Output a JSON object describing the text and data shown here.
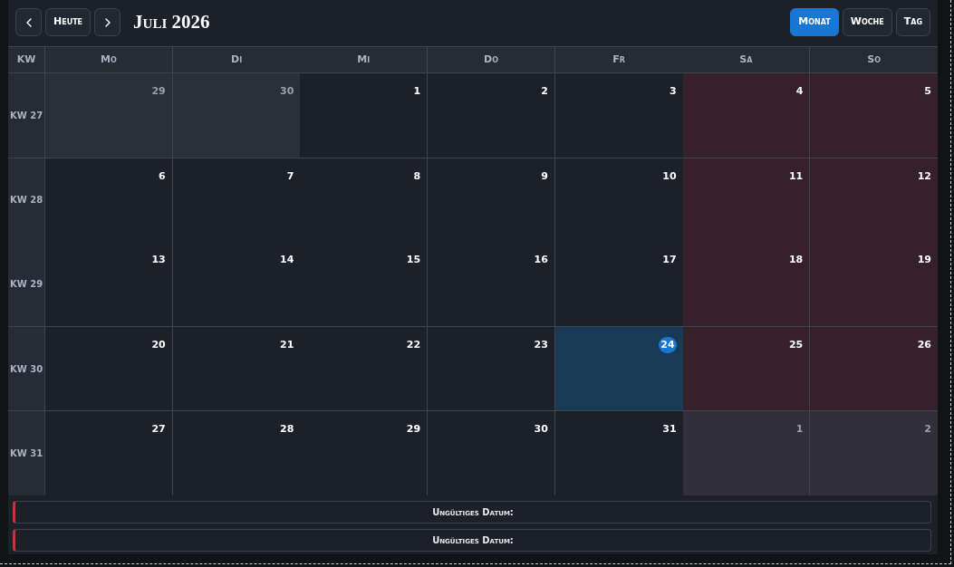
{
  "toolbar": {
    "today_button": "Heute",
    "title": "Juli 2026",
    "views": [
      {
        "label": "Monat",
        "selected": true
      },
      {
        "label": "Woche",
        "selected": false
      },
      {
        "label": "Tag",
        "selected": false
      }
    ]
  },
  "calendar": {
    "columns": [
      "KW",
      "Mo",
      "Di",
      "Mi",
      "Do",
      "Fr",
      "Sa",
      "So"
    ],
    "weeks": [
      {
        "label": "KW 27",
        "days": [
          {
            "day": "29",
            "outside_month": true,
            "weekend": false,
            "today": false
          },
          {
            "day": "30",
            "outside_month": true,
            "weekend": false,
            "today": false
          },
          {
            "day": "1",
            "outside_month": false,
            "weekend": false,
            "today": false
          },
          {
            "day": "2",
            "outside_month": false,
            "weekend": false,
            "today": false
          },
          {
            "day": "3",
            "outside_month": false,
            "weekend": false,
            "today": false
          },
          {
            "day": "4",
            "outside_month": false,
            "weekend": true,
            "today": false
          },
          {
            "day": "5",
            "outside_month": false,
            "weekend": true,
            "today": false
          }
        ]
      },
      {
        "label": "KW 28",
        "days": [
          {
            "day": "6",
            "outside_month": false,
            "weekend": false,
            "today": false
          },
          {
            "day": "7",
            "outside_month": false,
            "weekend": false,
            "today": false
          },
          {
            "day": "8",
            "outside_month": false,
            "weekend": false,
            "today": false
          },
          {
            "day": "9",
            "outside_month": false,
            "weekend": false,
            "today": false
          },
          {
            "day": "10",
            "outside_month": false,
            "weekend": false,
            "today": false
          },
          {
            "day": "11",
            "outside_month": false,
            "weekend": true,
            "today": false
          },
          {
            "day": "12",
            "outside_month": false,
            "weekend": true,
            "today": false
          }
        ]
      },
      {
        "label": "KW 29",
        "days": [
          {
            "day": "13",
            "outside_month": false,
            "weekend": false,
            "today": false
          },
          {
            "day": "14",
            "outside_month": false,
            "weekend": false,
            "today": false
          },
          {
            "day": "15",
            "outside_month": false,
            "weekend": false,
            "today": false
          },
          {
            "day": "16",
            "outside_month": false,
            "weekend": false,
            "today": false
          },
          {
            "day": "17",
            "outside_month": false,
            "weekend": false,
            "today": false
          },
          {
            "day": "18",
            "outside_month": false,
            "weekend": true,
            "today": false
          },
          {
            "day": "19",
            "outside_month": false,
            "weekend": true,
            "today": false
          }
        ]
      },
      {
        "label": "KW 30",
        "days": [
          {
            "day": "20",
            "outside_month": false,
            "weekend": false,
            "today": false
          },
          {
            "day": "21",
            "outside_month": false,
            "weekend": false,
            "today": false
          },
          {
            "day": "22",
            "outside_month": false,
            "weekend": false,
            "today": false
          },
          {
            "day": "23",
            "outside_month": false,
            "weekend": false,
            "today": false
          },
          {
            "day": "24",
            "outside_month": false,
            "weekend": false,
            "today": true
          },
          {
            "day": "25",
            "outside_month": false,
            "weekend": true,
            "today": false
          },
          {
            "day": "26",
            "outside_month": false,
            "weekend": true,
            "today": false
          }
        ]
      },
      {
        "label": "KW 31",
        "days": [
          {
            "day": "27",
            "outside_month": false,
            "weekend": false,
            "today": false
          },
          {
            "day": "28",
            "outside_month": false,
            "weekend": false,
            "today": false
          },
          {
            "day": "29",
            "outside_month": false,
            "weekend": false,
            "today": false
          },
          {
            "day": "30",
            "outside_month": false,
            "weekend": false,
            "today": false
          },
          {
            "day": "31",
            "outside_month": false,
            "weekend": false,
            "today": false
          },
          {
            "day": "1",
            "outside_month": true,
            "weekend": true,
            "today": false
          },
          {
            "day": "2",
            "outside_month": true,
            "weekend": true,
            "today": false
          }
        ]
      }
    ]
  },
  "alerts": [
    "Ungültiges Datum:",
    "Ungültiges Datum:"
  ]
}
